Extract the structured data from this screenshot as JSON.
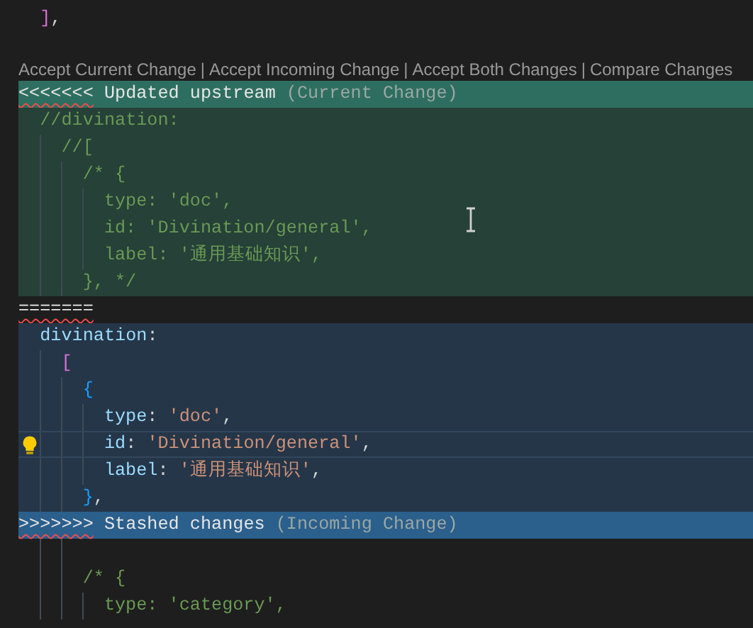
{
  "editor": {
    "blocks": [
      {
        "kind": "plain",
        "lines": [
          {
            "children": [
              {
                "tokens": [
                  {
                    "text": "]",
                    "kind": "bracket1"
                  },
                  {
                    "text": ",",
                    "kind": "punct"
                  }
                ]
              }
            ]
          },
          {
            "kind": "blank"
          }
        ]
      },
      {
        "kind": "codelens",
        "separator": "|",
        "actions": [
          "Accept Current Change",
          "Accept Incoming Change",
          "Accept Both Changes",
          "Compare Changes"
        ]
      },
      {
        "kind": "current",
        "marker": "<<<<<<<",
        "label": "Updated upstream",
        "note": "(Current Change)",
        "lines": [
          {
            "children": [
              {
                "tokens": [
                  {
                    "text": "//divination:",
                    "kind": "comment"
                  }
                ],
                "children": [
                  {
                    "tokens": [
                      {
                        "text": "//[",
                        "kind": "comment"
                      }
                    ],
                    "children": [
                      {
                        "tokens": [
                          {
                            "text": "/* {",
                            "kind": "comment"
                          }
                        ],
                        "children": [
                          {
                            "tokens": [
                              {
                                "text": "type: 'doc',",
                                "kind": "comment"
                              }
                            ]
                          },
                          {
                            "tokens": [
                              {
                                "text": "id: 'Divination/general',",
                                "kind": "comment"
                              }
                            ]
                          },
                          {
                            "tokens": [
                              {
                                "text": "label: '通用基础知识',",
                                "kind": "comment"
                              }
                            ]
                          }
                        ]
                      },
                      {
                        "tokens": [
                          {
                            "text": "}, */",
                            "kind": "comment"
                          }
                        ]
                      }
                    ]
                  }
                ]
              }
            ]
          }
        ]
      },
      {
        "kind": "separator",
        "marker": "======="
      },
      {
        "kind": "incoming",
        "marker": ">>>>>>>",
        "label": "Stashed changes",
        "note": "(Incoming Change)",
        "lines": [
          {
            "children": [
              {
                "tokens": [
                  {
                    "text": "divination",
                    "kind": "key"
                  },
                  {
                    "text": ":",
                    "kind": "punct"
                  }
                ],
                "children": [
                  {
                    "tokens": [
                      {
                        "text": "[",
                        "kind": "bracket1"
                      }
                    ],
                    "children": [
                      {
                        "tokens": [
                          {
                            "text": "{",
                            "kind": "bracket2"
                          }
                        ],
                        "children": [
                          {
                            "tokens": [
                              {
                                "text": "type",
                                "kind": "key"
                              },
                              {
                                "text": ": ",
                                "kind": "punct"
                              },
                              {
                                "text": "'doc'",
                                "kind": "string"
                              },
                              {
                                "text": ",",
                                "kind": "punct"
                              }
                            ]
                          },
                          {
                            "active": true,
                            "lightbulb": true,
                            "tokens": [
                              {
                                "text": "id",
                                "kind": "key"
                              },
                              {
                                "text": ": ",
                                "kind": "punct"
                              },
                              {
                                "text": "'Divination/general'",
                                "kind": "string"
                              },
                              {
                                "text": ",",
                                "kind": "punct"
                              }
                            ]
                          },
                          {
                            "tokens": [
                              {
                                "text": "label",
                                "kind": "key"
                              },
                              {
                                "text": ": ",
                                "kind": "punct"
                              },
                              {
                                "text": "'通用基础知识'",
                                "kind": "string"
                              },
                              {
                                "text": ",",
                                "kind": "punct"
                              }
                            ]
                          }
                        ]
                      },
                      {
                        "tokens": [
                          {
                            "text": "}",
                            "kind": "bracket2"
                          },
                          {
                            "text": ",",
                            "kind": "punct"
                          }
                        ]
                      }
                    ]
                  }
                ]
              }
            ]
          }
        ]
      },
      {
        "kind": "plain",
        "lines": [
          {
            "children": [
              {
                "children": [
                  {
                    "children": [
                      {
                        "kind": "blank"
                      },
                      {
                        "tokens": [
                          {
                            "text": "/* {",
                            "kind": "comment"
                          }
                        ],
                        "children": [
                          {
                            "tokens": [
                              {
                                "text": "type: 'category',",
                                "kind": "comment"
                              }
                            ]
                          }
                        ]
                      }
                    ]
                  }
                ]
              }
            ]
          }
        ]
      }
    ]
  }
}
